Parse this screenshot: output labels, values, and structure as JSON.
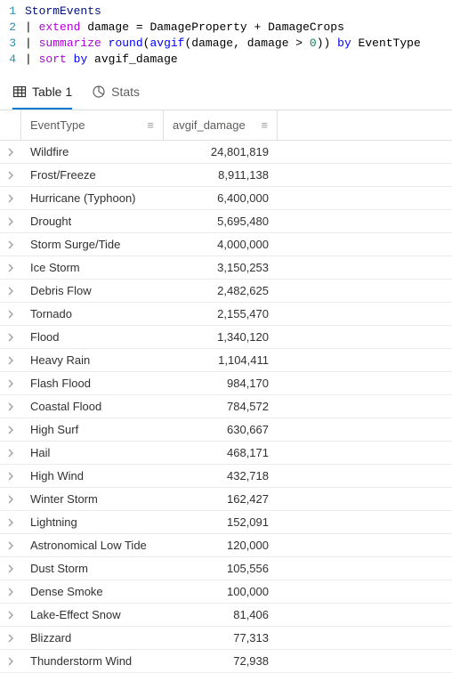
{
  "editor": {
    "lines": [
      {
        "n": "1",
        "tokens": [
          {
            "t": "StormEvents",
            "c": "tk-ident"
          }
        ]
      },
      {
        "n": "2",
        "tokens": [
          {
            "t": "| ",
            "c": "tk-plain"
          },
          {
            "t": "extend",
            "c": "tk-op"
          },
          {
            "t": " damage ",
            "c": "tk-plain"
          },
          {
            "t": "=",
            "c": "tk-plain"
          },
          {
            "t": " DamageProperty ",
            "c": "tk-plain"
          },
          {
            "t": "+",
            "c": "tk-plain"
          },
          {
            "t": " DamageCrops",
            "c": "tk-plain"
          }
        ]
      },
      {
        "n": "3",
        "tokens": [
          {
            "t": "| ",
            "c": "tk-plain"
          },
          {
            "t": "summarize",
            "c": "tk-op"
          },
          {
            "t": " ",
            "c": "tk-plain"
          },
          {
            "t": "round",
            "c": "tk-func"
          },
          {
            "t": "(",
            "c": "tk-plain"
          },
          {
            "t": "avgif",
            "c": "tk-func"
          },
          {
            "t": "(damage, damage > ",
            "c": "tk-plain"
          },
          {
            "t": "0",
            "c": "tk-num"
          },
          {
            "t": ")) ",
            "c": "tk-plain"
          },
          {
            "t": "by",
            "c": "tk-kw"
          },
          {
            "t": " EventType",
            "c": "tk-plain"
          }
        ]
      },
      {
        "n": "4",
        "tokens": [
          {
            "t": "| ",
            "c": "tk-plain"
          },
          {
            "t": "sort",
            "c": "tk-op"
          },
          {
            "t": " ",
            "c": "tk-plain"
          },
          {
            "t": "by",
            "c": "tk-kw"
          },
          {
            "t": " avgif_damage",
            "c": "tk-plain"
          }
        ]
      }
    ]
  },
  "tabs": {
    "table_label": "Table 1",
    "stats_label": "Stats"
  },
  "grid": {
    "headers": {
      "event": "EventType",
      "damage": "avgif_damage"
    },
    "rows": [
      {
        "event": "Wildfire",
        "damage": "24,801,819"
      },
      {
        "event": "Frost/Freeze",
        "damage": "8,911,138"
      },
      {
        "event": "Hurricane (Typhoon)",
        "damage": "6,400,000"
      },
      {
        "event": "Drought",
        "damage": "5,695,480"
      },
      {
        "event": "Storm Surge/Tide",
        "damage": "4,000,000"
      },
      {
        "event": "Ice Storm",
        "damage": "3,150,253"
      },
      {
        "event": "Debris Flow",
        "damage": "2,482,625"
      },
      {
        "event": "Tornado",
        "damage": "2,155,470"
      },
      {
        "event": "Flood",
        "damage": "1,340,120"
      },
      {
        "event": "Heavy Rain",
        "damage": "1,104,411"
      },
      {
        "event": "Flash Flood",
        "damage": "984,170"
      },
      {
        "event": "Coastal Flood",
        "damage": "784,572"
      },
      {
        "event": "High Surf",
        "damage": "630,667"
      },
      {
        "event": "Hail",
        "damage": "468,171"
      },
      {
        "event": "High Wind",
        "damage": "432,718"
      },
      {
        "event": "Winter Storm",
        "damage": "162,427"
      },
      {
        "event": "Lightning",
        "damage": "152,091"
      },
      {
        "event": "Astronomical Low Tide",
        "damage": "120,000"
      },
      {
        "event": "Dust Storm",
        "damage": "105,556"
      },
      {
        "event": "Dense Smoke",
        "damage": "100,000"
      },
      {
        "event": "Lake-Effect Snow",
        "damage": "81,406"
      },
      {
        "event": "Blizzard",
        "damage": "77,313"
      },
      {
        "event": "Thunderstorm Wind",
        "damage": "72,938"
      }
    ]
  }
}
